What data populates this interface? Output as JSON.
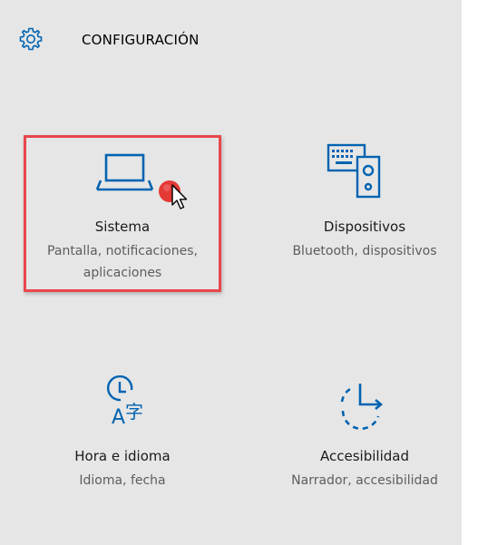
{
  "header": {
    "title": "CONFIGURACIÓN",
    "icon": "gear-icon"
  },
  "tiles": [
    {
      "icon": "laptop-icon",
      "label": "Sistema",
      "desc_lines": [
        "Pantalla, notificaciones,",
        "aplicaciones"
      ],
      "highlighted": true
    },
    {
      "icon": "keyboard-speaker-icon",
      "label": "Dispositivos",
      "desc_lines": [
        "Bluetooth, dispositivos"
      ]
    },
    {
      "icon": "clock-language-icon",
      "label": "Hora e idioma",
      "desc_lines": [
        "Idioma, fecha"
      ]
    },
    {
      "icon": "accessibility-timer-icon",
      "label": "Accesibilidad",
      "desc_lines": [
        "Narrador, accesibilidad"
      ]
    }
  ],
  "colors": {
    "accent": "#0063b1",
    "background": "#e6e6e6",
    "highlight_border": "#e8484c",
    "click_dot": "#e53935"
  }
}
